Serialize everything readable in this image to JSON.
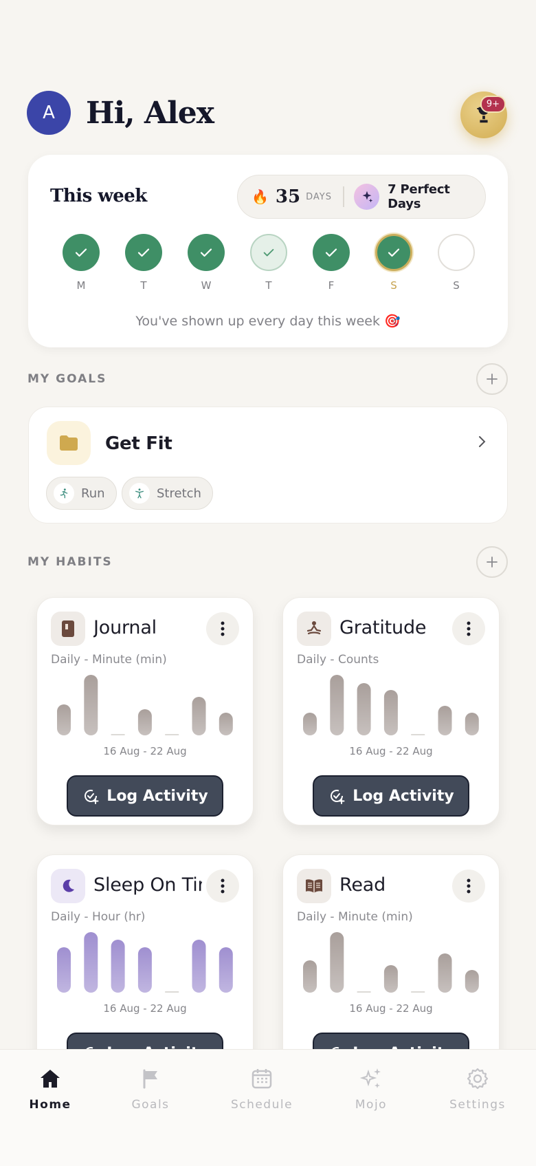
{
  "header": {
    "avatar_initial": "A",
    "greeting": "Hi, Alex",
    "trophy_badge": "9+"
  },
  "week": {
    "title": "This week",
    "streak_count": "35",
    "streak_unit": "DAYS",
    "perfect_days": "7 Perfect Days",
    "days": [
      {
        "label": "M",
        "state": "done"
      },
      {
        "label": "T",
        "state": "done"
      },
      {
        "label": "W",
        "state": "done"
      },
      {
        "label": "T",
        "state": "light"
      },
      {
        "label": "F",
        "state": "done"
      },
      {
        "label": "S",
        "state": "today"
      },
      {
        "label": "S",
        "state": "empty"
      }
    ],
    "message": "You've shown up every day this week 🎯"
  },
  "goals": {
    "section_title": "MY GOALS",
    "items": [
      {
        "name": "Get Fit",
        "chips": [
          "Run",
          "Stretch"
        ]
      }
    ]
  },
  "habits": {
    "section_title": "MY HABITS",
    "log_label": "Log Activity",
    "items": [
      {
        "name": "Journal",
        "subtitle": "Daily - Minute (min)",
        "range": "16 Aug - 22 Aug",
        "values": [
          0.45,
          0.88,
          0,
          0.38,
          0,
          0.56,
          0.33
        ],
        "color": "#a99f9b",
        "icon": "book-icon"
      },
      {
        "name": "Gratitude",
        "subtitle": "Daily - Counts",
        "range": "16 Aug - 22 Aug",
        "values": [
          0.33,
          0.88,
          0.76,
          0.66,
          0,
          0.43,
          0.33
        ],
        "color": "#a99f9b",
        "icon": "meditation-icon"
      },
      {
        "name": "Sleep On Time",
        "subtitle": "Daily - Hour (hr)",
        "range": "16 Aug - 22 Aug",
        "values": [
          0.66,
          0.88,
          0.77,
          0.66,
          0,
          0.77,
          0.66
        ],
        "color": "#9f8fd0",
        "icon": "moon-icon"
      },
      {
        "name": "Read",
        "subtitle": "Daily - Minute (min)",
        "range": "16 Aug - 22 Aug",
        "values": [
          0.47,
          0.88,
          0,
          0.4,
          0,
          0.57,
          0.33
        ],
        "color": "#a99f9b",
        "icon": "open-book-icon"
      }
    ]
  },
  "nav": {
    "items": [
      {
        "label": "Home",
        "icon": "home-icon",
        "active": true
      },
      {
        "label": "Goals",
        "icon": "flag-icon",
        "active": false
      },
      {
        "label": "Schedule",
        "icon": "calendar-icon",
        "active": false
      },
      {
        "label": "Mojo",
        "icon": "sparkles-icon",
        "active": false
      },
      {
        "label": "Settings",
        "icon": "gear-icon",
        "active": false
      }
    ]
  }
}
